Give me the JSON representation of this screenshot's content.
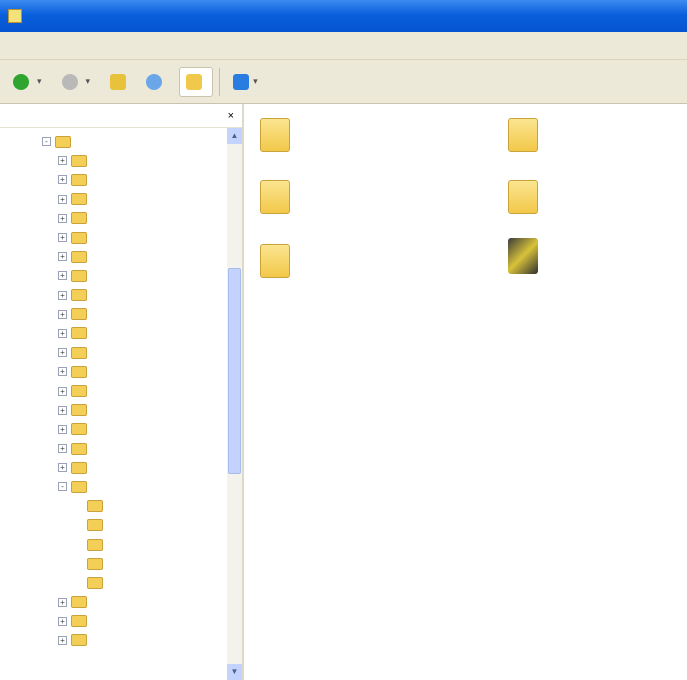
{
  "window": {
    "title": ""
  },
  "menu": {
    "items": [
      "",
      "",
      "",
      "",
      ""
    ]
  },
  "toolbar": {
    "back_label": "",
    "forward_label": "",
    "search_label": "",
    "folders_label": "",
    "views_label": ""
  },
  "folders_pane": {
    "title": "",
    "close": "×",
    "tree": [
      {
        "label": "",
        "level": 0,
        "expander": "-"
      },
      {
        "label": "",
        "level": 1,
        "expander": "+"
      },
      {
        "label": "",
        "level": 1,
        "expander": "+"
      },
      {
        "label": "",
        "level": 1,
        "expander": "+"
      },
      {
        "label": "",
        "level": 1,
        "expander": "+"
      },
      {
        "label": "",
        "level": 1,
        "expander": "+"
      },
      {
        "label": "",
        "level": 1,
        "expander": "+"
      },
      {
        "label": "",
        "level": 1,
        "expander": "+"
      },
      {
        "label": "",
        "level": 1,
        "expander": "+"
      },
      {
        "label": "",
        "level": 1,
        "expander": "+"
      },
      {
        "label": "",
        "level": 1,
        "expander": "+"
      },
      {
        "label": "",
        "level": 1,
        "expander": "+"
      },
      {
        "label": "",
        "level": 1,
        "expander": "+"
      },
      {
        "label": "",
        "level": 1,
        "expander": "+"
      },
      {
        "label": "",
        "level": 1,
        "expander": "+"
      },
      {
        "label": "",
        "level": 1,
        "expander": "+"
      },
      {
        "label": "",
        "level": 1,
        "expander": "+"
      },
      {
        "label": "",
        "level": 1,
        "expander": "+"
      },
      {
        "label": "",
        "level": 1,
        "expander": "-",
        "selected": true
      },
      {
        "label": "",
        "level": 2,
        "expander": ""
      },
      {
        "label": "",
        "level": 2,
        "expander": ""
      },
      {
        "label": "",
        "level": 2,
        "expander": ""
      },
      {
        "label": "",
        "level": 2,
        "expander": ""
      },
      {
        "label": "",
        "level": 2,
        "expander": ""
      },
      {
        "label": "",
        "level": 1,
        "expander": "+"
      },
      {
        "label": "",
        "level": 1,
        "expander": "+"
      },
      {
        "label": "",
        "level": 1,
        "expander": "+"
      }
    ]
  },
  "content": {
    "items": [
      {
        "name": "",
        "type": "folder"
      },
      {
        "name": "",
        "type": "folder"
      },
      {
        "name": "",
        "type": "folder"
      },
      {
        "name": "",
        "type": "folder"
      },
      {
        "name": "",
        "type": "folder"
      },
      {
        "name": "",
        "subtitle": "",
        "type": "wizard"
      }
    ]
  }
}
